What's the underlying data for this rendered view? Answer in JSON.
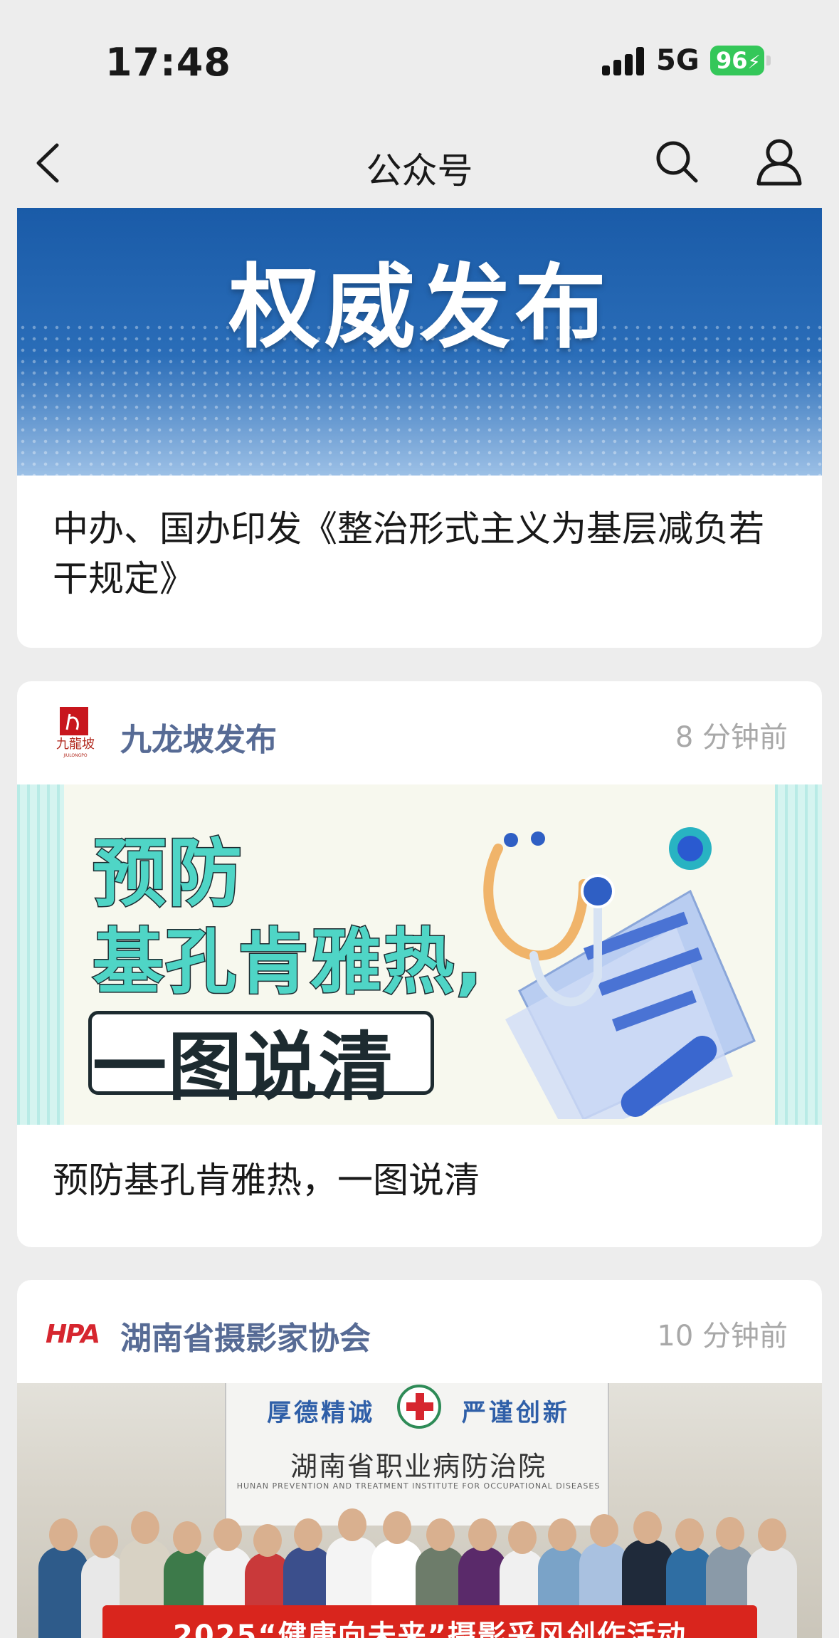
{
  "status_bar": {
    "time": "17:48",
    "network": "5G",
    "battery": "96"
  },
  "nav": {
    "title": "公众号",
    "icons": [
      "back-icon",
      "search-icon",
      "profile-icon"
    ]
  },
  "feed": [
    {
      "banner_text": "权威发布",
      "headline": "中办、国办印发《整治形式主义为基层减负若干规定》"
    },
    {
      "account": "九龙坡发布",
      "time": "8 分钟前",
      "image_text": {
        "line1": "预防",
        "line2": "基孔肯雅热,",
        "line3": "一图说清"
      },
      "headline": "预防基孔肯雅热，一图说清"
    },
    {
      "account": "湖南省摄影家协会",
      "logo_text": "HPA",
      "time": "10 分钟前",
      "image_text": {
        "sign_top_left": "厚德精诚",
        "sign_top_right": "严谨创新",
        "sign_main": "湖南省职业病防治院",
        "sign_sub": "HUNAN PREVENTION AND TREATMENT INSTITUTE FOR OCCUPATIONAL DISEASES",
        "banner": "2025“健康向未来”摄影采风创作活动"
      }
    }
  ],
  "colors": {
    "account_name": "#576b95",
    "time": "#a8a8a8",
    "battery": "#34c759"
  }
}
